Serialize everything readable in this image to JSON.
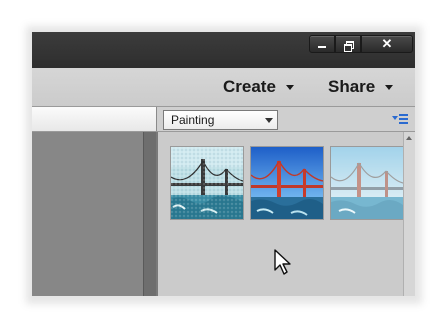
{
  "window": {
    "controls": {
      "minimize": "minimize",
      "restore": "restore",
      "close": "close"
    }
  },
  "menubar": {
    "items": [
      {
        "label": "Create",
        "icon": "chevron-down-icon"
      },
      {
        "label": "Share",
        "icon": "chevron-down-icon"
      }
    ]
  },
  "effects_panel": {
    "category": {
      "selected": "Painting"
    },
    "list_menu_icon": "panel-menu-icon",
    "thumbnails": [
      {
        "name": "painting-effect-1",
        "style": "textured"
      },
      {
        "name": "painting-effect-2",
        "style": "vivid"
      },
      {
        "name": "painting-effect-3",
        "style": "faded"
      }
    ]
  },
  "colors": {
    "titlebar": "#333333",
    "menubar": "#cfcfcf",
    "left_panel": "#878787",
    "right_panel": "#cbcbcb",
    "accent": "#2a6ad0"
  }
}
